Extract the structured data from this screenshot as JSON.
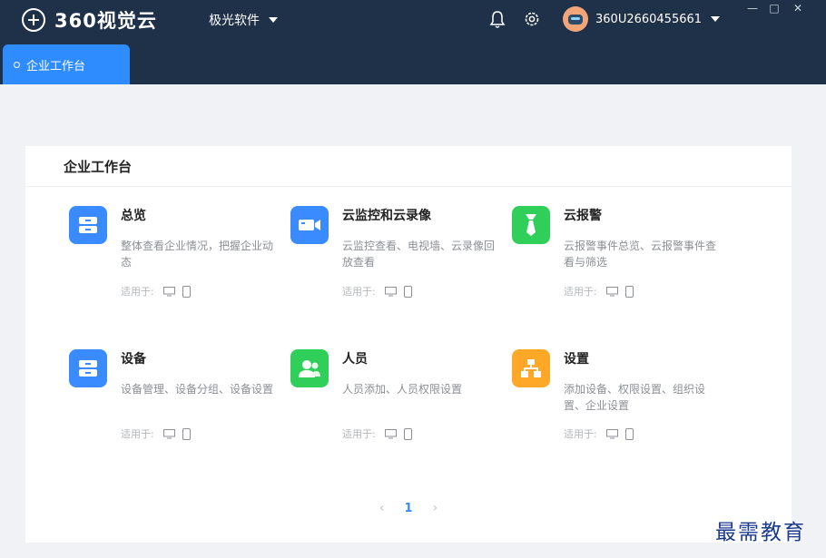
{
  "header": {
    "app_name": "360视觉云",
    "org_name": "极光软件",
    "user_name": "360U2660455661",
    "window_controls": [
      "—",
      "□",
      "✕"
    ]
  },
  "tabs": [
    {
      "label": "企业工作台",
      "active": true
    }
  ],
  "workspace": {
    "title": "企业工作台",
    "apply_label": "适用于:",
    "tiles": [
      {
        "title": "总览",
        "desc": "整体查看企业情况，把握企业动态",
        "icon": "drawer-icon",
        "color": "#3a8bff"
      },
      {
        "title": "云监控和云录像",
        "desc": "云监控查看、电视墙、云录像回放查看",
        "icon": "camera-icon",
        "color": "#3a8bff"
      },
      {
        "title": "云报警",
        "desc": "云报警事件总览、云报警事件查看与筛选",
        "icon": "alarm-icon",
        "color": "#2fcf5a"
      },
      {
        "title": "设备",
        "desc": "设备管理、设备分组、设备设置",
        "icon": "device-icon",
        "color": "#3a8bff"
      },
      {
        "title": "人员",
        "desc": "人员添加、人员权限设置",
        "icon": "people-icon",
        "color": "#2fcf5a"
      },
      {
        "title": "设置",
        "desc": "添加设备、权限设置、组织设置、企业设置",
        "icon": "org-chart-icon",
        "color": "#ffa726"
      }
    ]
  },
  "pagination": {
    "prev": "‹",
    "current": "1",
    "next": "›"
  },
  "watermark": "最需教育"
}
